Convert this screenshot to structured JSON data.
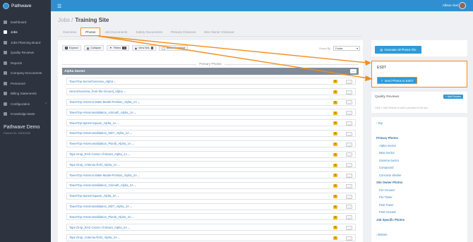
{
  "app": {
    "name": "Pathwave"
  },
  "topbar": {
    "user_name": "Allison Abel"
  },
  "sidebar": {
    "items": [
      {
        "label": "Dashboard",
        "icon": "dashboard-icon",
        "active": false
      },
      {
        "label": "Jobs",
        "icon": "jobs-icon",
        "active": true
      },
      {
        "label": "Jobs Planning Board",
        "icon": "planning-icon",
        "active": false
      },
      {
        "label": "Quality Reviews",
        "icon": "quality-icon",
        "active": false
      },
      {
        "label": "Reports",
        "icon": "reports-icon",
        "active": false
      },
      {
        "label": "Company Documents",
        "icon": "documents-icon",
        "active": false
      },
      {
        "label": "Personnel",
        "icon": "personnel-icon",
        "active": false
      },
      {
        "label": "Billing Statements",
        "icon": "billing-icon",
        "active": false
      },
      {
        "label": "Configuration",
        "icon": "gear-icon",
        "active": false
      },
      {
        "label": "Knowledge Base",
        "icon": "knowledge-icon",
        "active": false
      }
    ],
    "company_name": "Pathwave Demo",
    "partner_id": "Partner ID: 23232323"
  },
  "breadcrumb": {
    "parent": "Jobs",
    "separator": "/",
    "current": "Training Site"
  },
  "tabs": [
    {
      "label": "Overview",
      "active": false
    },
    {
      "label": "Photos",
      "active": true
    },
    {
      "label": "Job Documents",
      "active": false
    },
    {
      "label": "Safety Documents",
      "active": false
    },
    {
      "label": "Primary Closeout",
      "active": false
    },
    {
      "label": "Site Owner Closeout",
      "active": false
    }
  ],
  "toolbar": {
    "expand_label": "Expand",
    "expand_count": "0",
    "collapse_label": "Collapse",
    "filters_label": "Filters",
    "filters_count": "13",
    "view_na_label": "View N/A",
    "view_na_count": "0",
    "show_guidance_label": "Show Guidance",
    "group_by_label": "Group By",
    "group_by_value": "Folder"
  },
  "primary_photos": {
    "section_title": "Primary Photos",
    "group_name": "Alpha Sector",
    "group_button": "...",
    "rows": [
      {
        "label": "TowerTop-SectorOverview_Alpha",
        "count": "0"
      },
      {
        "label": "SectorOverview_from-the-Ground_Alpha",
        "count": "0"
      },
      {
        "label": "TowerTop-Antenna Make-Model-Position_Alpha_1A",
        "count": "0"
      },
      {
        "label": "TowerTop-AntennaValidation_Azimuth_Alpha_1A",
        "count": "0"
      },
      {
        "label": "TowerTop-Speed-Square_Alpha_1A",
        "count": "0"
      },
      {
        "label": "TowerTop-AntennaValidation_MDT_Alpha_1A",
        "count": "0"
      },
      {
        "label": "TowerTop-AntennaValidation_Plumb_Alpha_1A",
        "count": "0"
      },
      {
        "label": "Tape Drop_RAD Center of Mount_Alpha_1A",
        "count": "0"
      },
      {
        "label": "Tape Drop_Antenna RAD_Alpha_1A",
        "count": "0"
      },
      {
        "label": "TowerTop-Antenna Make-Model-Position_Alpha_2A",
        "count": "0"
      },
      {
        "label": "TowerTop-AntennaValidation_Azimuth_Alpha_2A",
        "count": "0"
      },
      {
        "label": "TowerTop-Speed-Square_Alpha_2A",
        "count": "0"
      },
      {
        "label": "TowerTop-AntennaValidation_MDT_Alpha_2A",
        "count": "0"
      },
      {
        "label": "TowerTop-AntennaValidation_Plumb_Alpha_2A",
        "count": "0"
      },
      {
        "label": "Tape Drop_RAD Center of Mount_Alpha_2A",
        "count": "0"
      },
      {
        "label": "Tape Drop_Antenna RAD_Alpha_2A",
        "count": "0"
      }
    ],
    "row_menu": "..."
  },
  "right": {
    "generate_btn": "Generate All Photos File",
    "esdt_title": "ESDT",
    "esdt_btn": "Send Photos to ESDT",
    "qr_title": "Quality Reviews",
    "qr_add": "+ Add Review",
    "qr_hint": "Click + Add Review to add a preview to this job",
    "nav_top": "↑ Top",
    "nav_bottom": "↓ Bottom",
    "nav": [
      {
        "label": "Primary Photos",
        "type": "head"
      },
      {
        "label": "Alpha Sector",
        "type": "link"
      },
      {
        "label": "Beta Sector",
        "type": "link"
      },
      {
        "label": "Gamma Sector",
        "type": "link"
      },
      {
        "label": "Compound",
        "type": "link"
      },
      {
        "label": "Concrete Shelter",
        "type": "link"
      },
      {
        "label": "Site Owner Photos",
        "type": "head"
      },
      {
        "label": "Pre Ground",
        "type": "link"
      },
      {
        "label": "Pre Tower",
        "type": "link"
      },
      {
        "label": "Post Tower",
        "type": "link"
      },
      {
        "label": "Post Ground",
        "type": "link"
      },
      {
        "label": "Job Specific Photos",
        "type": "head"
      }
    ]
  },
  "colors": {
    "accent": "#2f8fd1",
    "highlight": "#f28c1a",
    "sidebar": "#2d3440"
  }
}
